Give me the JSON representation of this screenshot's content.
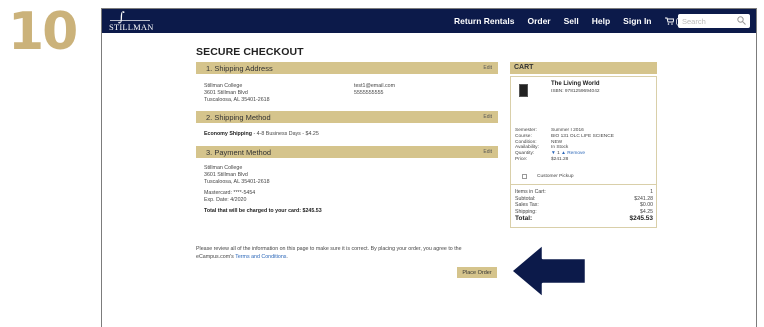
{
  "step": "10",
  "nav": {
    "logo_text": "STILLMAN",
    "links": [
      "Return Rentals",
      "Order",
      "Sell",
      "Help",
      "Sign In"
    ],
    "cart_count": "(1)",
    "search_placeholder": "Search"
  },
  "checkout": {
    "title": "SECURE CHECKOUT",
    "edit_label": "Edit",
    "shipping_address": {
      "heading": "1. Shipping Address",
      "lines": [
        "Stillman College",
        "3601 Stillman Blvd",
        "Tuscaloosa, AL 35401-2618"
      ],
      "email": "test1@email.com",
      "phone": "5555555555"
    },
    "shipping_method": {
      "heading": "2. Shipping Method",
      "name": "Economy Shipping",
      "detail": " - 4-8 Business Days - $4.25"
    },
    "payment_method": {
      "heading": "3. Payment Method",
      "lines": [
        "Stillman College",
        "3601 Stillman Blvd",
        "Tuscaloosa, AL 35401-2618"
      ],
      "card": "Mastercard: ****-5454",
      "exp": "Exp. Date: 4/2020",
      "total_line": "Total that will be charged to your card: $245.53"
    },
    "review_text": "Please review all of the information on this page to make sure it is correct. By placing your order, you agree to the eCampus.com's ",
    "terms_link": "Terms and Conditions",
    "review_end": ".",
    "place_order": "Place Order"
  },
  "cart": {
    "heading": "CART",
    "item": {
      "title": "The Living World",
      "isbn": "ISBN: 9781259694042",
      "details": [
        {
          "k": "Semester:",
          "v": "Summer I 2016"
        },
        {
          "k": "Course:",
          "v": "BIO 131 OLC LIFE SCIENCE"
        },
        {
          "k": "Condition:",
          "v": "NEW"
        },
        {
          "k": "Availability:",
          "v": "In Stock"
        },
        {
          "k": "Quantity:",
          "v": "1"
        },
        {
          "k": "Price:",
          "v": "$241.28"
        }
      ],
      "remove_label": "Remove",
      "pickup_label": "Customer Pickup"
    },
    "summary": [
      {
        "k": "Items in Cart:",
        "v": "1"
      },
      {
        "k": "Subtotal:",
        "v": "$241.28"
      },
      {
        "k": "Sales Tax:",
        "v": "$0.00"
      },
      {
        "k": "Shipping:",
        "v": "$4.25"
      }
    ],
    "total_label": "Total:",
    "total_value": "$245.53"
  },
  "colors": {
    "nav_bg": "#0c1a4a",
    "section_bar": "#d5c48c",
    "step_gold": "#cbb27a",
    "arrow": "#0c1a4a",
    "link": "#2a66b8"
  }
}
